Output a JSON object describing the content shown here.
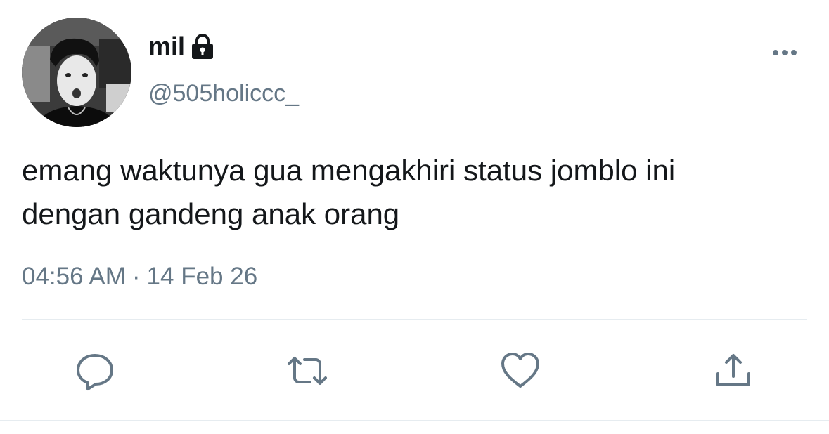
{
  "tweet": {
    "display_name": "mil",
    "handle": "@505holiccc_",
    "text_lines": [
      "emang waktunya gua mengakhiri status jomblo ini",
      "dengan gandeng anak orang"
    ],
    "time": "04:56 AM",
    "separator": "·",
    "date": "14 Feb 26"
  },
  "icons": {
    "protected": "lock-icon",
    "more": "more-horizontal-icon",
    "reply": "reply-bubble-icon",
    "retweet": "retweet-icon",
    "like": "heart-icon",
    "share": "share-upload-icon"
  },
  "colors": {
    "text_primary": "#14171a",
    "text_secondary": "#657786",
    "divider": "#e6ecf0",
    "icon": "#657786"
  }
}
